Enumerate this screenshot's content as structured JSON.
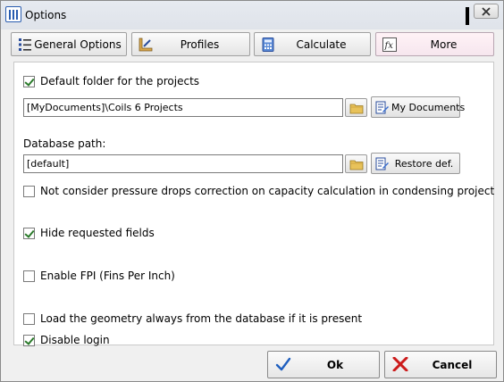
{
  "window": {
    "title": "Options"
  },
  "tabs": [
    {
      "label": "General Options",
      "icon": "list-icon"
    },
    {
      "label": "Profiles",
      "icon": "ruler-icon"
    },
    {
      "label": "Calculate",
      "icon": "calculator-icon"
    },
    {
      "label": "More",
      "icon": "fx-icon",
      "active": true
    }
  ],
  "options": {
    "default_folder": {
      "label": "Default folder for the projects",
      "checked": true
    },
    "project_folder": {
      "value": "[MyDocuments]\\Coils 6 Projects",
      "button_label": "My Documents"
    },
    "database": {
      "label": "Database path:",
      "value": "[default]",
      "button_label": "Restore def."
    },
    "pressure_drops": {
      "label": "Not consider pressure drops correction on capacity calculation in condensing project",
      "checked": false
    },
    "hide_requested": {
      "label": "Hide requested fields",
      "checked": true
    },
    "enable_fpi": {
      "label": "Enable FPI (Fins Per Inch)",
      "checked": false
    },
    "load_geometry": {
      "label": "Load the geometry always from the database if it is present",
      "checked": false
    },
    "disable_login": {
      "label": "Disable login",
      "checked": true
    }
  },
  "footer": {
    "ok_label": "Ok",
    "cancel_label": "Cancel"
  },
  "colors": {
    "check_green": "#2a7a2a",
    "ok_blue": "#1f5fbf",
    "cancel_red": "#cc1b1b"
  }
}
